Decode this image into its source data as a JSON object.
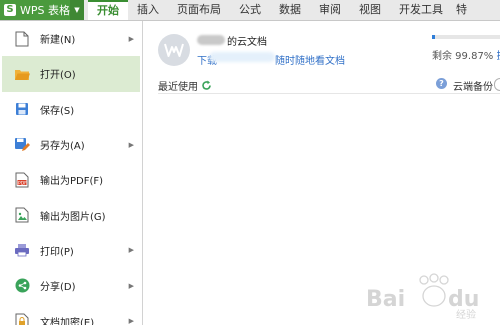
{
  "app": {
    "title": "WPS 表格",
    "logo_letter": "S"
  },
  "ribbon": {
    "tabs": [
      "开始",
      "插入",
      "页面布局",
      "公式",
      "数据",
      "审阅",
      "视图",
      "开发工具",
      "特"
    ],
    "active_tab": "开始"
  },
  "file_menu": {
    "items": [
      {
        "label": "新建(N)",
        "icon": "new-doc-icon",
        "has_submenu": true
      },
      {
        "label": "打开(O)",
        "icon": "open-folder-icon",
        "has_submenu": false,
        "active": true
      },
      {
        "label": "保存(S)",
        "icon": "save-icon",
        "has_submenu": false
      },
      {
        "label": "另存为(A)",
        "icon": "save-as-icon",
        "has_submenu": true
      },
      {
        "label": "输出为PDF(F)",
        "icon": "pdf-export-icon",
        "has_submenu": false
      },
      {
        "label": "输出为图片(G)",
        "icon": "image-export-icon",
        "has_submenu": false
      },
      {
        "label": "打印(P)",
        "icon": "print-icon",
        "has_submenu": true
      },
      {
        "label": "分享(D)",
        "icon": "share-icon",
        "has_submenu": true
      },
      {
        "label": "文档加密(E)",
        "icon": "encrypt-icon",
        "has_submenu": true
      }
    ]
  },
  "cloud": {
    "title_suffix": "的云文档",
    "link_prefix": "下载",
    "link_suffix": "随时随地看文档",
    "storage_label": "剩余 99.87%",
    "storage_remaining_pct": 99.87,
    "expand_label": "扩"
  },
  "recent": {
    "label": "最近使用",
    "backup_label": "云端备份"
  },
  "watermark": {
    "brand": "Bai du",
    "sub": "经验"
  },
  "colors": {
    "brand_green": "#4a9a3d",
    "active_item_bg": "#dcebd2",
    "link_blue": "#2f6fc7"
  }
}
